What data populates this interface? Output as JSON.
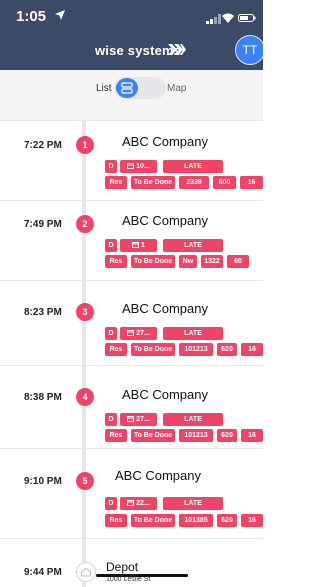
{
  "status": {
    "time": "1:05"
  },
  "header": {
    "brand": "wise systems",
    "avatar": "TT"
  },
  "toggle": {
    "left": "List",
    "right": "Map"
  },
  "stops": [
    {
      "time": "7:22 PM",
      "badge": "1",
      "name": "ABC Company",
      "chips_row1": [
        "D",
        "10...",
        "LATE"
      ],
      "chips_row2": [
        "Res",
        "To Be Done",
        "2339",
        "600",
        "16"
      ]
    },
    {
      "time": "7:49 PM",
      "badge": "2",
      "name": "ABC Company",
      "chips_row1": [
        "D",
        "1",
        "LATE"
      ],
      "chips_row2": [
        "Res",
        "To Be Done",
        "Nw",
        "1322",
        "60"
      ]
    },
    {
      "time": "8:23 PM",
      "badge": "3",
      "name": "ABC Company",
      "chips_row1": [
        "D",
        "27...",
        "LATE"
      ],
      "chips_row2": [
        "Res",
        "To Be Done",
        "101213",
        "620",
        "16"
      ]
    },
    {
      "time": "8:38 PM",
      "badge": "4",
      "name": "ABC Company",
      "chips_row1": [
        "D",
        "27...",
        "LATE"
      ],
      "chips_row2": [
        "Res",
        "To Be Done",
        "101213",
        "620",
        "16"
      ]
    },
    {
      "time": "9:10 PM",
      "badge": "5",
      "name": "ABC Company",
      "chips_row1": [
        "D",
        "22...",
        "LATE"
      ],
      "chips_row2": [
        "Res",
        "To Be Done",
        "101385",
        "620",
        "16"
      ]
    }
  ],
  "depot": {
    "time": "9:44 PM",
    "name": "Depot",
    "address": "1000 Leslie St"
  },
  "colors": {
    "header": "#3b4a66",
    "accent": "#3b82f6",
    "chip": "#ef4466"
  }
}
